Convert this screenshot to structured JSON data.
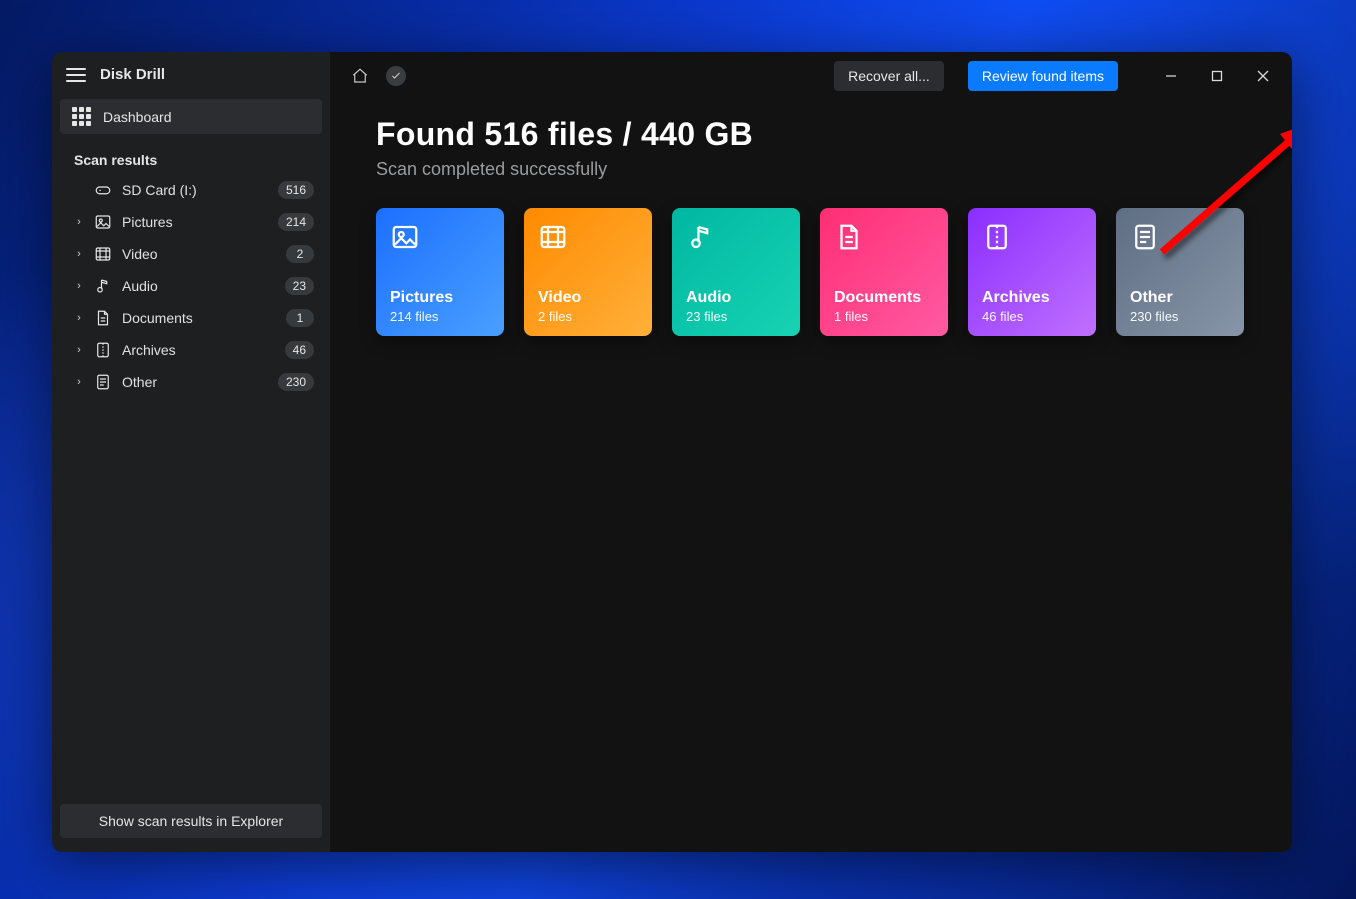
{
  "app": {
    "title": "Disk Drill"
  },
  "sidebar": {
    "dashboard_label": "Dashboard",
    "section_label": "Scan results",
    "items": [
      {
        "label": "SD Card (I:)",
        "count": "516",
        "icon": "drive",
        "expandable": false
      },
      {
        "label": "Pictures",
        "count": "214",
        "icon": "pictures",
        "expandable": true
      },
      {
        "label": "Video",
        "count": "2",
        "icon": "video",
        "expandable": true
      },
      {
        "label": "Audio",
        "count": "23",
        "icon": "audio",
        "expandable": true
      },
      {
        "label": "Documents",
        "count": "1",
        "icon": "documents",
        "expandable": true
      },
      {
        "label": "Archives",
        "count": "46",
        "icon": "archives",
        "expandable": true
      },
      {
        "label": "Other",
        "count": "230",
        "icon": "other",
        "expandable": true
      }
    ],
    "footer_button": "Show scan results in Explorer"
  },
  "toolbar": {
    "recover_all_label": "Recover all...",
    "review_label": "Review found items"
  },
  "main": {
    "headline": "Found 516 files / 440 GB",
    "subhead": "Scan completed successfully",
    "cards": [
      {
        "title": "Pictures",
        "count": "214 files",
        "style": "grad-pic",
        "icon": "pictures"
      },
      {
        "title": "Video",
        "count": "2 files",
        "style": "grad-vid",
        "icon": "video"
      },
      {
        "title": "Audio",
        "count": "23 files",
        "style": "grad-aud",
        "icon": "audio"
      },
      {
        "title": "Documents",
        "count": "1 files",
        "style": "grad-doc",
        "icon": "documents"
      },
      {
        "title": "Archives",
        "count": "46 files",
        "style": "grad-arc",
        "icon": "archives"
      },
      {
        "title": "Other",
        "count": "230 files",
        "style": "grad-oth",
        "icon": "other"
      }
    ]
  }
}
